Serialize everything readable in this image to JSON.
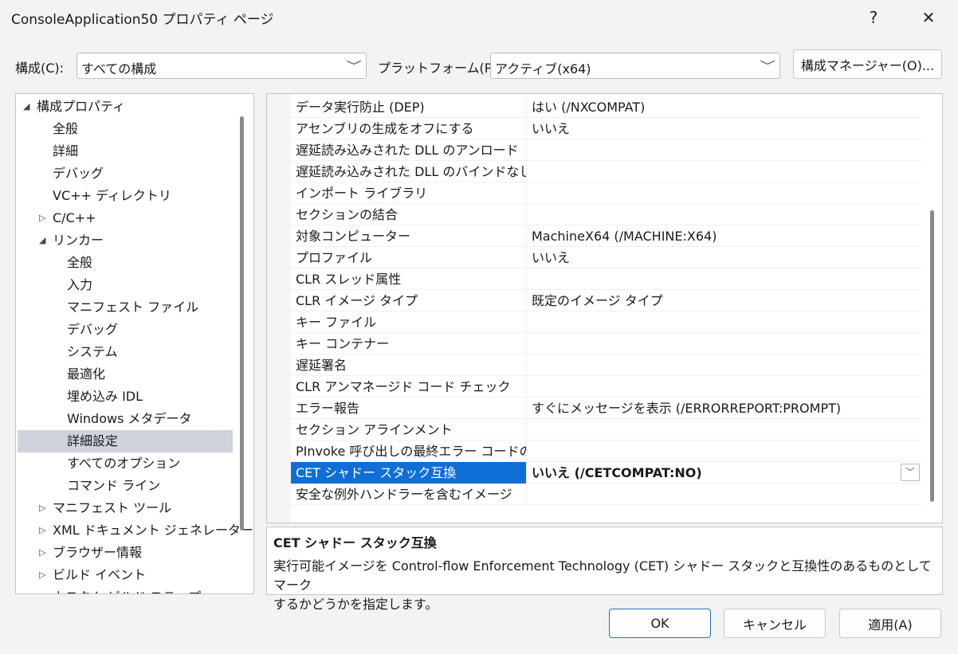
{
  "window": {
    "title": "ConsoleApplication50 プロパティ ページ",
    "help_glyph": "?",
    "close_glyph": "✕"
  },
  "config": {
    "label": "構成(C):",
    "value": "すべての構成",
    "platform_label": "プラットフォーム(P):",
    "platform_value": "アクティブ(x64)",
    "manager_button": "構成マネージャー(O)..."
  },
  "tree": {
    "items": [
      {
        "label": "構成プロパティ",
        "indent": 0,
        "arrow": "expanded"
      },
      {
        "label": "全般",
        "indent": 1
      },
      {
        "label": "詳細",
        "indent": 1
      },
      {
        "label": "デバッグ",
        "indent": 1
      },
      {
        "label": "VC++ ディレクトリ",
        "indent": 1
      },
      {
        "label": "C/C++",
        "indent": 1,
        "arrow": "collapsed"
      },
      {
        "label": "リンカー",
        "indent": 1,
        "arrow": "expanded"
      },
      {
        "label": "全般",
        "indent": 2
      },
      {
        "label": "入力",
        "indent": 2
      },
      {
        "label": "マニフェスト ファイル",
        "indent": 2
      },
      {
        "label": "デバッグ",
        "indent": 2
      },
      {
        "label": "システム",
        "indent": 2
      },
      {
        "label": "最適化",
        "indent": 2
      },
      {
        "label": "埋め込み IDL",
        "indent": 2
      },
      {
        "label": "Windows メタデータ",
        "indent": 2
      },
      {
        "label": "詳細設定",
        "indent": 2,
        "selected": true
      },
      {
        "label": "すべてのオプション",
        "indent": 2
      },
      {
        "label": "コマンド ライン",
        "indent": 2
      },
      {
        "label": "マニフェスト ツール",
        "indent": 1,
        "arrow": "collapsed"
      },
      {
        "label": "XML ドキュメント ジェネレーター",
        "indent": 1,
        "arrow": "collapsed"
      },
      {
        "label": "ブラウザー情報",
        "indent": 1,
        "arrow": "collapsed"
      },
      {
        "label": "ビルド イベント",
        "indent": 1,
        "arrow": "collapsed"
      },
      {
        "label": "カスタム ビルド ステップ",
        "indent": 1,
        "arrow": "collapsed"
      }
    ]
  },
  "properties": [
    {
      "name": "データ実行防止 (DEP)",
      "value": "はい (/NXCOMPAT)"
    },
    {
      "name": "アセンブリの生成をオフにする",
      "value": "いいえ"
    },
    {
      "name": "遅延読み込みされた DLL のアンロード",
      "value": ""
    },
    {
      "name": "遅延読み込みされた DLL のバインドなし",
      "value": ""
    },
    {
      "name": "インポート ライブラリ",
      "value": ""
    },
    {
      "name": "セクションの結合",
      "value": ""
    },
    {
      "name": "対象コンピューター",
      "value": "MachineX64 (/MACHINE:X64)"
    },
    {
      "name": "プロファイル",
      "value": "いいえ"
    },
    {
      "name": "CLR スレッド属性",
      "value": ""
    },
    {
      "name": "CLR イメージ タイプ",
      "value": "既定のイメージ タイプ"
    },
    {
      "name": "キー ファイル",
      "value": ""
    },
    {
      "name": "キー コンテナー",
      "value": ""
    },
    {
      "name": "遅延署名",
      "value": ""
    },
    {
      "name": "CLR アンマネージド コード チェック",
      "value": ""
    },
    {
      "name": "エラー報告",
      "value": "すぐにメッセージを表示 (/ERRORREPORT:PROMPT)"
    },
    {
      "name": "セクション アラインメント",
      "value": ""
    },
    {
      "name": "PInvoke 呼び出しの最終エラー コードの保",
      "value": ""
    },
    {
      "name": "CET シャドー スタック互換",
      "value": "いいえ (/CETCOMPAT:NO)",
      "selected": true
    },
    {
      "name": "安全な例外ハンドラーを含むイメージ",
      "value": ""
    }
  ],
  "description": {
    "title": "CET シャドー スタック互換",
    "line1": "実行可能イメージを Control-flow Enforcement Technology (CET) シャドー スタックと互換性のあるものとしてマーク",
    "line2": "するかどうかを指定します。"
  },
  "buttons": {
    "ok": "OK",
    "cancel": "キャンセル",
    "apply": "適用(A)"
  }
}
